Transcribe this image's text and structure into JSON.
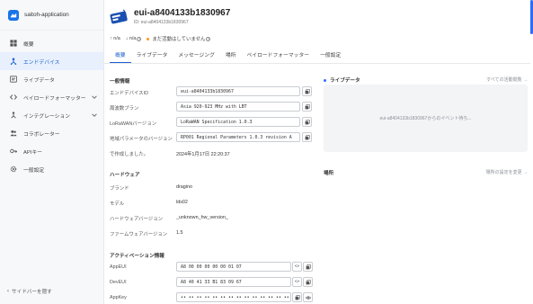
{
  "app": {
    "name": "saitoh-application"
  },
  "sidebar": {
    "items": [
      {
        "label": "概要",
        "icon": "grid-icon"
      },
      {
        "label": "エンドデバイス",
        "icon": "device-icon",
        "active": true
      },
      {
        "label": "ライブデータ",
        "icon": "list-icon"
      },
      {
        "label": "ペイロードフォーマッター",
        "icon": "code-icon",
        "expandable": true
      },
      {
        "label": "インテグレーション",
        "icon": "integration-icon",
        "expandable": true
      },
      {
        "label": "コラボレーター",
        "icon": "users-icon"
      },
      {
        "label": "APIキー",
        "icon": "key-icon"
      },
      {
        "label": "一般設定",
        "icon": "gear-icon"
      }
    ],
    "collapse_label": "サイドバーを隠す"
  },
  "device": {
    "title": "eui-a8404133b1830967",
    "id_line": "ID: eui-a8404133b1830967"
  },
  "stats": {
    "up": "n/a",
    "down": "n/a",
    "status": "まだ活動はしていません"
  },
  "tabs": [
    "概要",
    "ライブデータ",
    "メッセージング",
    "場所",
    "ペイロードフォーマッター",
    "一般設定"
  ],
  "general": {
    "title": "一般情報",
    "device_id_label": "エンドデバイスID",
    "device_id_value": "eui-a8404133b1830967",
    "freq_label": "周波数プラン",
    "freq_value": "Asia 920-923 MHz with LBT",
    "lorawan_label": "LoRaWANバージョン",
    "lorawan_value": "LoRaWAN Specification 1.0.3",
    "regional_label": "地域パラメータのバージョン",
    "regional_value": "RP001 Regional Parameters 1.0.3 revision A",
    "created_label": "で作成しました。",
    "created_value": "2024年1月17日 22:20:37"
  },
  "hardware": {
    "title": "ハードウェア",
    "brand_label": "ブランド",
    "brand_value": "dragino",
    "model_label": "モデル",
    "model_value": "lds02",
    "hw_label": "ハードウェアバージョン",
    "hw_value": "_unknown_hw_version_",
    "fw_label": "ファームウェアバージョン",
    "fw_value": "1.5"
  },
  "activation": {
    "title": "アクティベーション情報",
    "appeui_label": "AppEUI",
    "appeui_value": "A8 00 00 00 00 00 01 07",
    "deveui_label": "DevEUI",
    "deveui_value": "A8 40 41 33 B1 83 09 67",
    "appkey_label": "AppKey",
    "appkey_value": "•• •• •• •• •• •• •• •• •• •• •• •• •• •• •• ••"
  },
  "live": {
    "title": "ライブデータ",
    "link": "すべての活動閲覧 →",
    "waiting": "eui-a8404133b1830967からのイベント待ち..."
  },
  "location": {
    "title": "場所",
    "link": "場所の設定を変更 →"
  },
  "colors": {
    "accent": "#1a5fd0",
    "brand": "#1a73e8",
    "status_dot": "#f59c1a"
  }
}
